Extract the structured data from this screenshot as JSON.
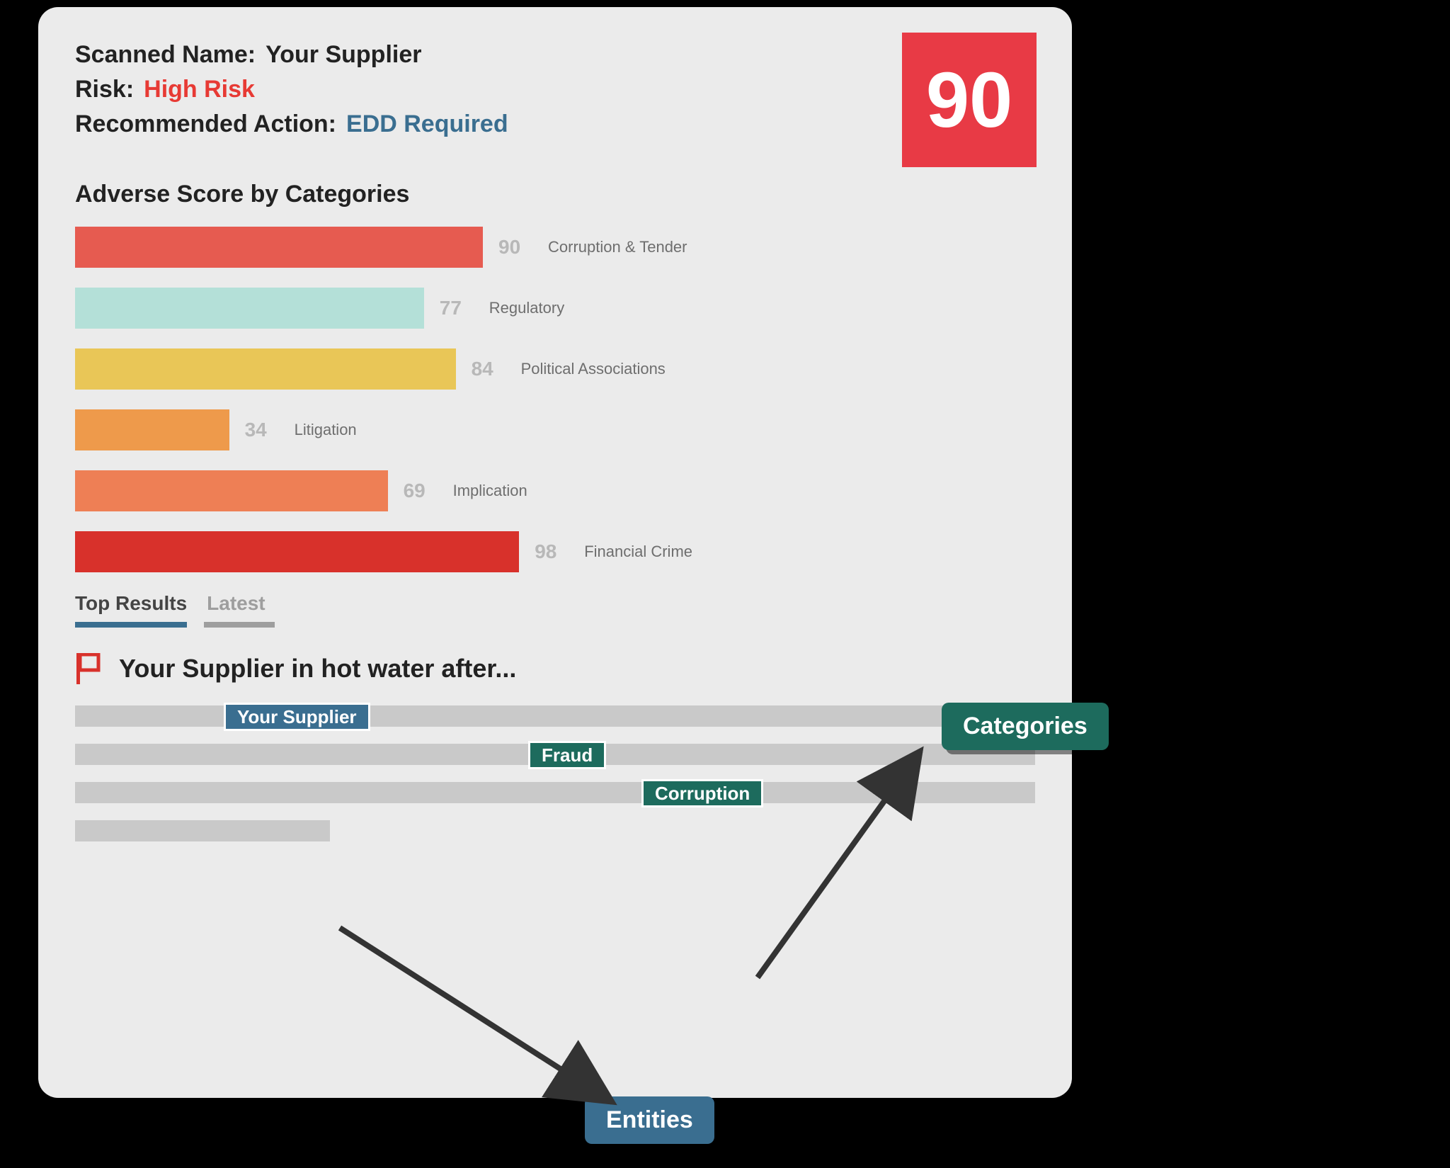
{
  "header": {
    "scanned_label": "Scanned Name:",
    "scanned_value": "Your Supplier",
    "risk_label": "Risk:",
    "risk_value": "High Risk",
    "action_label": "Recommended Action:",
    "action_value": "EDD Required",
    "score": "90"
  },
  "chart_section_title": "Adverse Score by Categories",
  "chart_data": {
    "type": "bar",
    "orientation": "horizontal",
    "categories": [
      "Corruption & Tender",
      "Regulatory",
      "Political Associations",
      "Litigation",
      "Implication",
      "Financial Crime"
    ],
    "values": [
      90,
      77,
      84,
      34,
      69,
      98
    ],
    "colors": [
      "#e65b50",
      "#b4e0d8",
      "#e9c657",
      "#ee9a4b",
      "#ee7f55",
      "#d8312b"
    ],
    "xlim": [
      0,
      100
    ],
    "title": "Adverse Score by Categories",
    "xlabel": "",
    "ylabel": ""
  },
  "tabs": {
    "items": [
      "Top Results",
      "Latest"
    ],
    "active_index": 0
  },
  "article": {
    "title": "Your Supplier in hot water after...",
    "tags": {
      "entity": "Your Supplier",
      "category1": "Fraud",
      "category2": "Corruption"
    }
  },
  "callouts": {
    "categories": "Categories",
    "entities": "Entities"
  }
}
